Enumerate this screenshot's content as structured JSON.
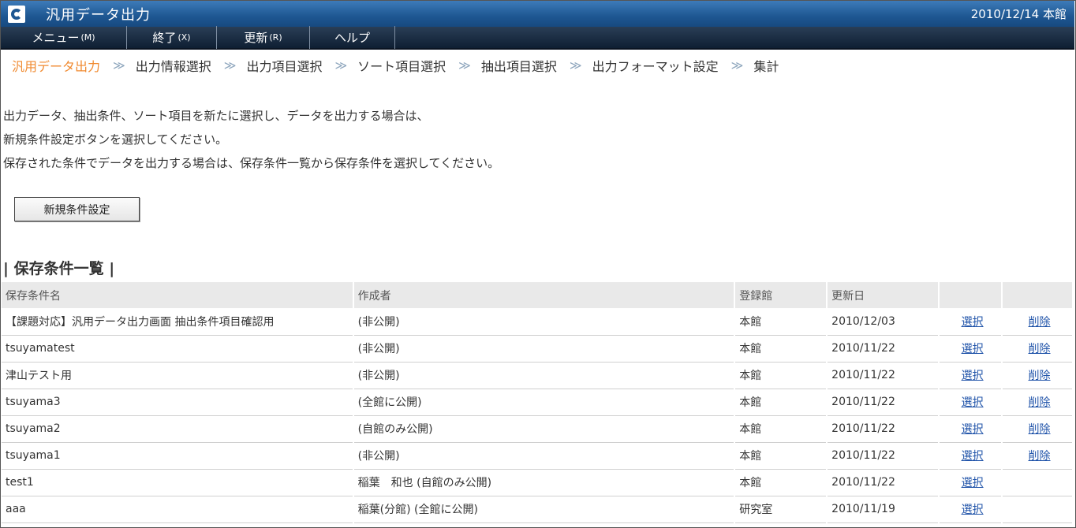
{
  "titlebar": {
    "title": "汎用データ出力",
    "date_info": "2010/12/14 本館"
  },
  "menubar": {
    "items": [
      {
        "label": "メニュー",
        "accel": "(M)"
      },
      {
        "label": "終了",
        "accel": "(X)"
      },
      {
        "label": "更新",
        "accel": "(R)"
      },
      {
        "label": "ヘルプ",
        "accel": ""
      }
    ]
  },
  "breadcrumb": {
    "separator": "≫",
    "steps": [
      "汎用データ出力",
      "出力情報選択",
      "出力項目選択",
      "ソート項目選択",
      "抽出項目選択",
      "出力フォーマット設定",
      "集計"
    ]
  },
  "intro": {
    "lines": [
      "出力データ、抽出条件、ソート項目を新たに選択し、データを出力する場合は、",
      "新規条件設定ボタンを選択してください。",
      "保存された条件でデータを出力する場合は、保存条件一覧から保存条件を選択してください。"
    ]
  },
  "new_button_label": "新規条件設定",
  "section_title": "保存条件一覧",
  "table": {
    "headers": {
      "name": "保存条件名",
      "author": "作成者",
      "hall": "登録館",
      "date": "更新日"
    },
    "select_label": "選択",
    "delete_label": "削除",
    "rows": [
      {
        "name": "【課題対応】汎用データ出力画面 抽出条件項目確認用",
        "author": "(非公開)",
        "hall": "本館",
        "date": "2010/12/03",
        "deletable": true
      },
      {
        "name": "tsuyamatest",
        "author": "(非公開)",
        "hall": "本館",
        "date": "2010/11/22",
        "deletable": true
      },
      {
        "name": "津山テスト用",
        "author": "(非公開)",
        "hall": "本館",
        "date": "2010/11/22",
        "deletable": true
      },
      {
        "name": "tsuyama3",
        "author": "(全館に公開)",
        "hall": "本館",
        "date": "2010/11/22",
        "deletable": true
      },
      {
        "name": "tsuyama2",
        "author": "(自館のみ公開)",
        "hall": "本館",
        "date": "2010/11/22",
        "deletable": true
      },
      {
        "name": "tsuyama1",
        "author": "(非公開)",
        "hall": "本館",
        "date": "2010/11/22",
        "deletable": true
      },
      {
        "name": "test1",
        "author": "稲葉　和也 (自館のみ公開)",
        "hall": "本館",
        "date": "2010/11/22",
        "deletable": false
      },
      {
        "name": "aaa",
        "author": "稲葉(分館) (全館に公開)",
        "hall": "研究室",
        "date": "2010/11/19",
        "deletable": false
      }
    ]
  }
}
